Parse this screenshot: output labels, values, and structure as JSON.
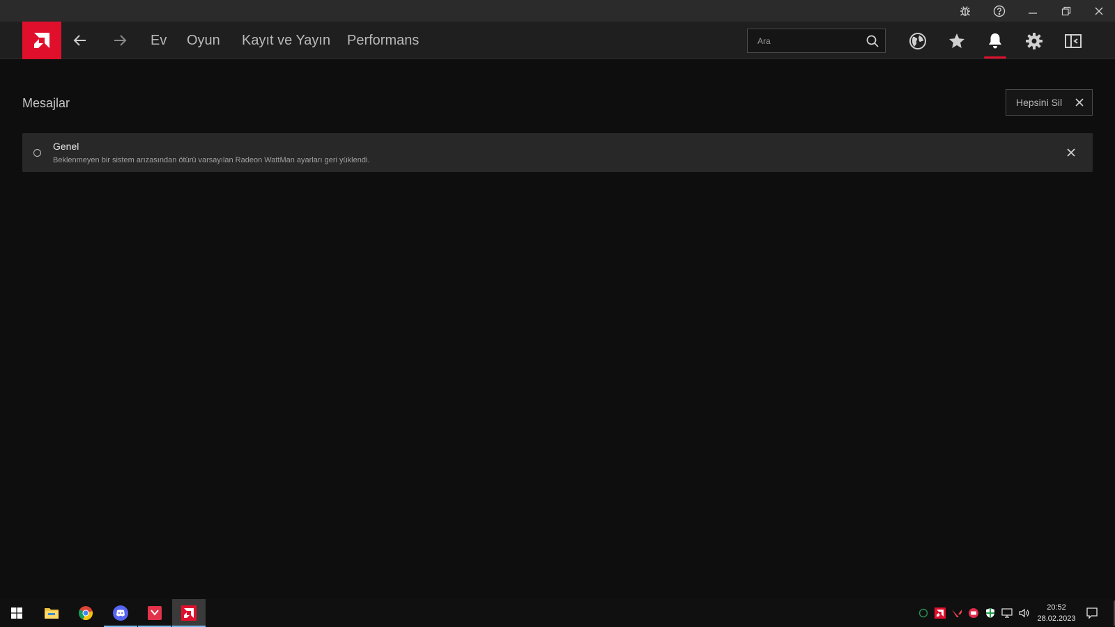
{
  "nav": {
    "links": [
      "Ev",
      "Oyun",
      "Kayıt ve Yayın",
      "Performans"
    ],
    "search_placeholder": "Ara"
  },
  "content": {
    "title": "Mesajlar",
    "clear_all_label": "Hepsini Sil",
    "messages": [
      {
        "title": "Genel",
        "body": "Beklenmeyen bir sistem arızasından ötürü varsayılan Radeon WattMan ayarları geri yüklendi."
      }
    ]
  },
  "taskbar": {
    "time": "20:52",
    "date": "28.02.2023"
  },
  "colors": {
    "accent": "#e0102d",
    "background": "#0e0e0e",
    "card": "#282828"
  },
  "icons": {
    "titlebar": [
      "bug-report-icon",
      "help-icon",
      "minimize-icon",
      "restore-icon",
      "close-icon"
    ],
    "nav": [
      "globe-icon",
      "star-icon",
      "bell-icon",
      "gear-icon",
      "sidebar-toggle-icon"
    ]
  }
}
